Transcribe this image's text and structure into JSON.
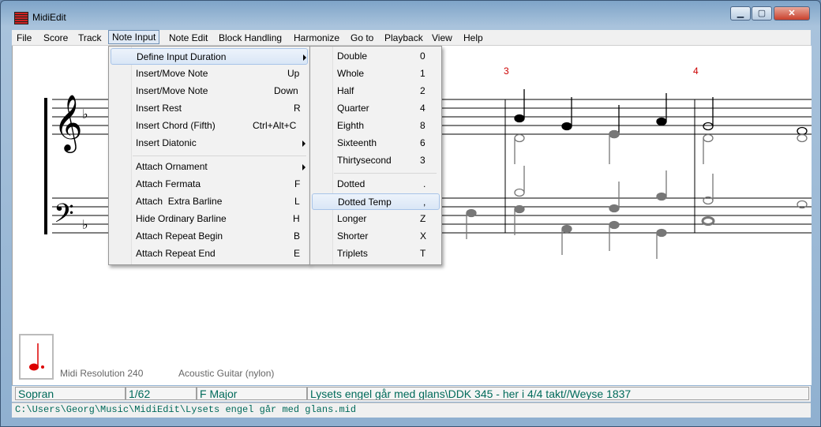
{
  "window": {
    "title": "MidiEdit"
  },
  "menubar": [
    "File",
    "Score",
    "Track",
    "Note Input",
    "Note Edit",
    "Block Handling",
    "Harmonize",
    "Go to",
    "Playback",
    "View",
    "Help"
  ],
  "note_input_menu": [
    {
      "label": "Define Input Duration",
      "shortcut": "",
      "submenu": true
    },
    {
      "label": "Insert/Move Note",
      "shortcut": "Up"
    },
    {
      "label": "Insert/Move Note",
      "shortcut": "Down"
    },
    {
      "label": "Insert Rest",
      "shortcut": "R"
    },
    {
      "label": "Insert Chord (Fifth)",
      "shortcut": "Ctrl+Alt+C"
    },
    {
      "label": "Insert Diatonic",
      "shortcut": "",
      "submenu": true
    },
    {
      "label": "Attach Ornament",
      "shortcut": "",
      "submenu": true
    },
    {
      "label": "Attach Fermata",
      "shortcut": "F"
    },
    {
      "label": "Attach  Extra Barline",
      "shortcut": "L"
    },
    {
      "label": "Hide Ordinary Barline",
      "shortcut": "H"
    },
    {
      "label": "Attach Repeat Begin",
      "shortcut": "B"
    },
    {
      "label": "Attach Repeat End",
      "shortcut": "E"
    }
  ],
  "duration_menu": [
    {
      "label": "Double",
      "shortcut": "0"
    },
    {
      "label": "Whole",
      "shortcut": "1"
    },
    {
      "label": "Half",
      "shortcut": "2"
    },
    {
      "label": "Quarter",
      "shortcut": "4"
    },
    {
      "label": "Eighth",
      "shortcut": "8"
    },
    {
      "label": "Sixteenth",
      "shortcut": "6"
    },
    {
      "label": "Thirtysecond",
      "shortcut": "3"
    },
    {
      "label": "Dotted",
      "shortcut": "."
    },
    {
      "label": "Dotted Temp",
      "shortcut": ","
    },
    {
      "label": "Longer",
      "shortcut": "Z"
    },
    {
      "label": "Shorter",
      "shortcut": "X"
    },
    {
      "label": "Triplets",
      "shortcut": "T"
    }
  ],
  "score": {
    "measure_numbers": [
      "3",
      "4"
    ]
  },
  "info": {
    "resolution": "Midi Resolution 240",
    "instrument": "Acoustic Guitar (nylon)"
  },
  "status": {
    "voice": "Sopran",
    "position": "1/62",
    "key": "F Major",
    "song": "Lysets engel går med glans\\DDK 345 - her i 4/4 takt//Weyse 1837"
  },
  "path": "C:\\Users\\Georg\\Music\\MidiEdit\\Lysets engel går med glans.mid",
  "colors": {
    "accent": "#006a5a",
    "measure": "#cc0000"
  }
}
